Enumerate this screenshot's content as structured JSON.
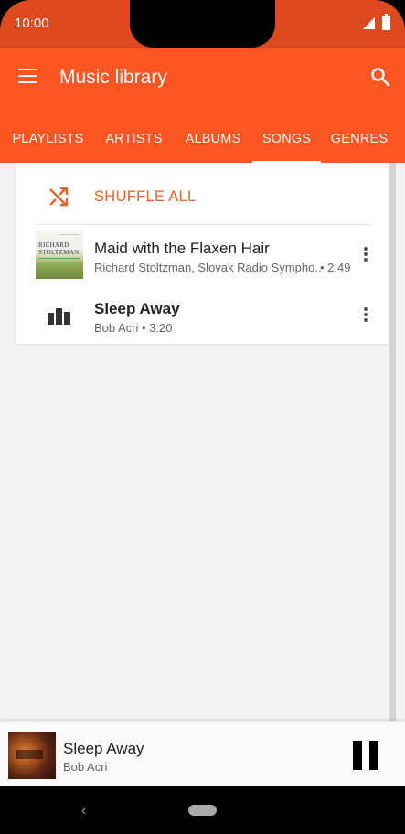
{
  "status_bar": {
    "time": "10:00"
  },
  "app_bar": {
    "title": "Music library"
  },
  "tabs": [
    {
      "label": "PLAYLISTS"
    },
    {
      "label": "ARTISTS"
    },
    {
      "label": "ALBUMS"
    },
    {
      "label": "SONGS",
      "active": true
    },
    {
      "label": "GENRES"
    }
  ],
  "shuffle": {
    "label": "SHUFFLE ALL"
  },
  "songs": [
    {
      "title": "Maid with the Flaxen Hair",
      "subtitle": "Richard Stoltzman, Slovak Radio Sympho..",
      "duration": "• 2:49",
      "art_text_line1": "RICHARD",
      "art_text_line2": "STOLTZMAN"
    },
    {
      "title": "Sleep Away",
      "subtitle": "Bob Acri • 3:20",
      "playing": true
    }
  ],
  "now_playing": {
    "title": "Sleep Away",
    "artist": "Bob Acri"
  },
  "colors": {
    "accent": "#fe5622",
    "status_bar": "#dd4a1f",
    "shuffle_text": "#e4622c"
  }
}
